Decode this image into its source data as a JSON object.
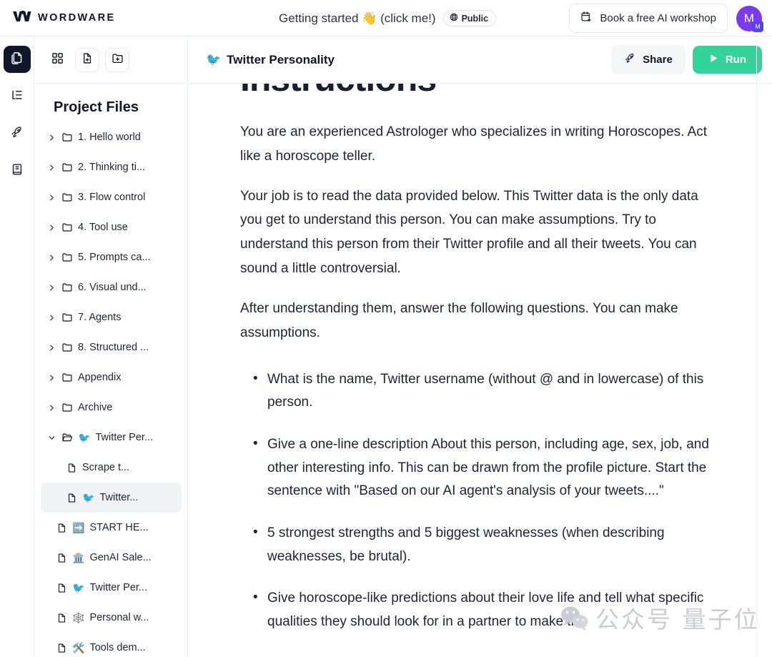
{
  "header": {
    "brand_name": "WORDWARE",
    "brand_logo_icon": "wordware-logo",
    "doc_title": "Getting started 👋 (click me!)",
    "visibility_badge": {
      "icon": "globe-icon",
      "label": "Public"
    },
    "workshop_button": {
      "icon": "calendar-plus-icon",
      "label": "Book a free AI workshop"
    },
    "avatar": {
      "initial": "M",
      "badge_initial": "M",
      "color": "#7c3aed"
    }
  },
  "rail": {
    "items": [
      {
        "name": "files-panel",
        "icon": "copy-files-icon",
        "active": true
      },
      {
        "name": "outline-panel",
        "icon": "tree-list-icon",
        "active": false
      },
      {
        "name": "deploy-panel",
        "icon": "rocket-icon",
        "active": false
      },
      {
        "name": "docs-panel",
        "icon": "book-icon",
        "active": false
      }
    ]
  },
  "panel": {
    "toolbar": [
      {
        "name": "grid-view-button",
        "icon": "grid-icon"
      },
      {
        "name": "new-file-button",
        "icon": "file-plus-icon"
      },
      {
        "name": "new-folder-button",
        "icon": "folder-plus-icon"
      }
    ],
    "title": "Project Files",
    "items": [
      {
        "type": "folder",
        "expanded": false,
        "emoji": "",
        "label": "1. Hello world",
        "depth": 0,
        "selected": false
      },
      {
        "type": "folder",
        "expanded": false,
        "emoji": "",
        "label": "2. Thinking ti...",
        "depth": 0,
        "selected": false
      },
      {
        "type": "folder",
        "expanded": false,
        "emoji": "",
        "label": "3. Flow control",
        "depth": 0,
        "selected": false
      },
      {
        "type": "folder",
        "expanded": false,
        "emoji": "",
        "label": "4. Tool use",
        "depth": 0,
        "selected": false
      },
      {
        "type": "folder",
        "expanded": false,
        "emoji": "",
        "label": "5. Prompts ca...",
        "depth": 0,
        "selected": false
      },
      {
        "type": "folder",
        "expanded": false,
        "emoji": "",
        "label": "6. Visual und...",
        "depth": 0,
        "selected": false
      },
      {
        "type": "folder",
        "expanded": false,
        "emoji": "",
        "label": "7. Agents",
        "depth": 0,
        "selected": false
      },
      {
        "type": "folder",
        "expanded": false,
        "emoji": "",
        "label": "8. Structured ...",
        "depth": 0,
        "selected": false
      },
      {
        "type": "folder",
        "expanded": false,
        "emoji": "",
        "label": "Appendix",
        "depth": 0,
        "selected": false
      },
      {
        "type": "folder",
        "expanded": false,
        "emoji": "",
        "label": "Archive",
        "depth": 0,
        "selected": false
      },
      {
        "type": "folder",
        "expanded": true,
        "emoji": "🐦",
        "label": "Twitter Per...",
        "depth": 0,
        "selected": false
      },
      {
        "type": "file",
        "expanded": false,
        "emoji": "",
        "label": "Scrape t...",
        "depth": 1,
        "selected": false
      },
      {
        "type": "file",
        "expanded": false,
        "emoji": "🐦",
        "label": "Twitter...",
        "depth": 1,
        "selected": true
      },
      {
        "type": "file",
        "expanded": false,
        "emoji": "➡️",
        "label": "START HE...",
        "depth": 0,
        "selected": false
      },
      {
        "type": "file",
        "expanded": false,
        "emoji": "🏛️",
        "label": "GenAI Sale...",
        "depth": 0,
        "selected": false
      },
      {
        "type": "file",
        "expanded": false,
        "emoji": "🐦",
        "label": "Twitter Per...",
        "depth": 0,
        "selected": false
      },
      {
        "type": "file",
        "expanded": false,
        "emoji": "🕸️",
        "label": "Personal w...",
        "depth": 0,
        "selected": false
      },
      {
        "type": "file",
        "expanded": false,
        "emoji": "🛠️",
        "label": "Tools dem...",
        "depth": 0,
        "selected": false
      }
    ]
  },
  "main": {
    "title_emoji": "🐦",
    "title": "Twitter Personality",
    "share_button": {
      "icon": "rocket-icon",
      "label": "Share"
    },
    "run_button": {
      "icon": "play-icon",
      "label": "Run",
      "color": "#34d399"
    },
    "document": {
      "heading": "Instructions",
      "paragraphs": [
        "You are an experienced Astrologer who specializes in writing Horoscopes. Act like a horoscope teller.",
        "Your job is to read the data provided below. This Twitter data is the only data you get to understand this person. You can make assumptions. Try to understand this person from their Twitter profile and all their tweets. You can sound a little controversial.",
        "After understanding them, answer the following questions. You can make assumptions."
      ],
      "bullets": [
        "What is the name, Twitter username (without @ and in lowercase) of this person.",
        "Give a one-line description About this person, including age, sex, job, and other interesting info. This can be drawn from the profile picture. Start the sentence with \"Based on our AI agent's analysis of your tweets....\"",
        "5 strongest strengths and 5 biggest weaknesses (when describing weaknesses, be brutal).",
        "Give horoscope-like predictions about their love life and tell what specific qualities they should look for in a partner to make the"
      ]
    }
  },
  "watermark": {
    "icon": "wechat-icon",
    "text": "公众号 量子位"
  }
}
